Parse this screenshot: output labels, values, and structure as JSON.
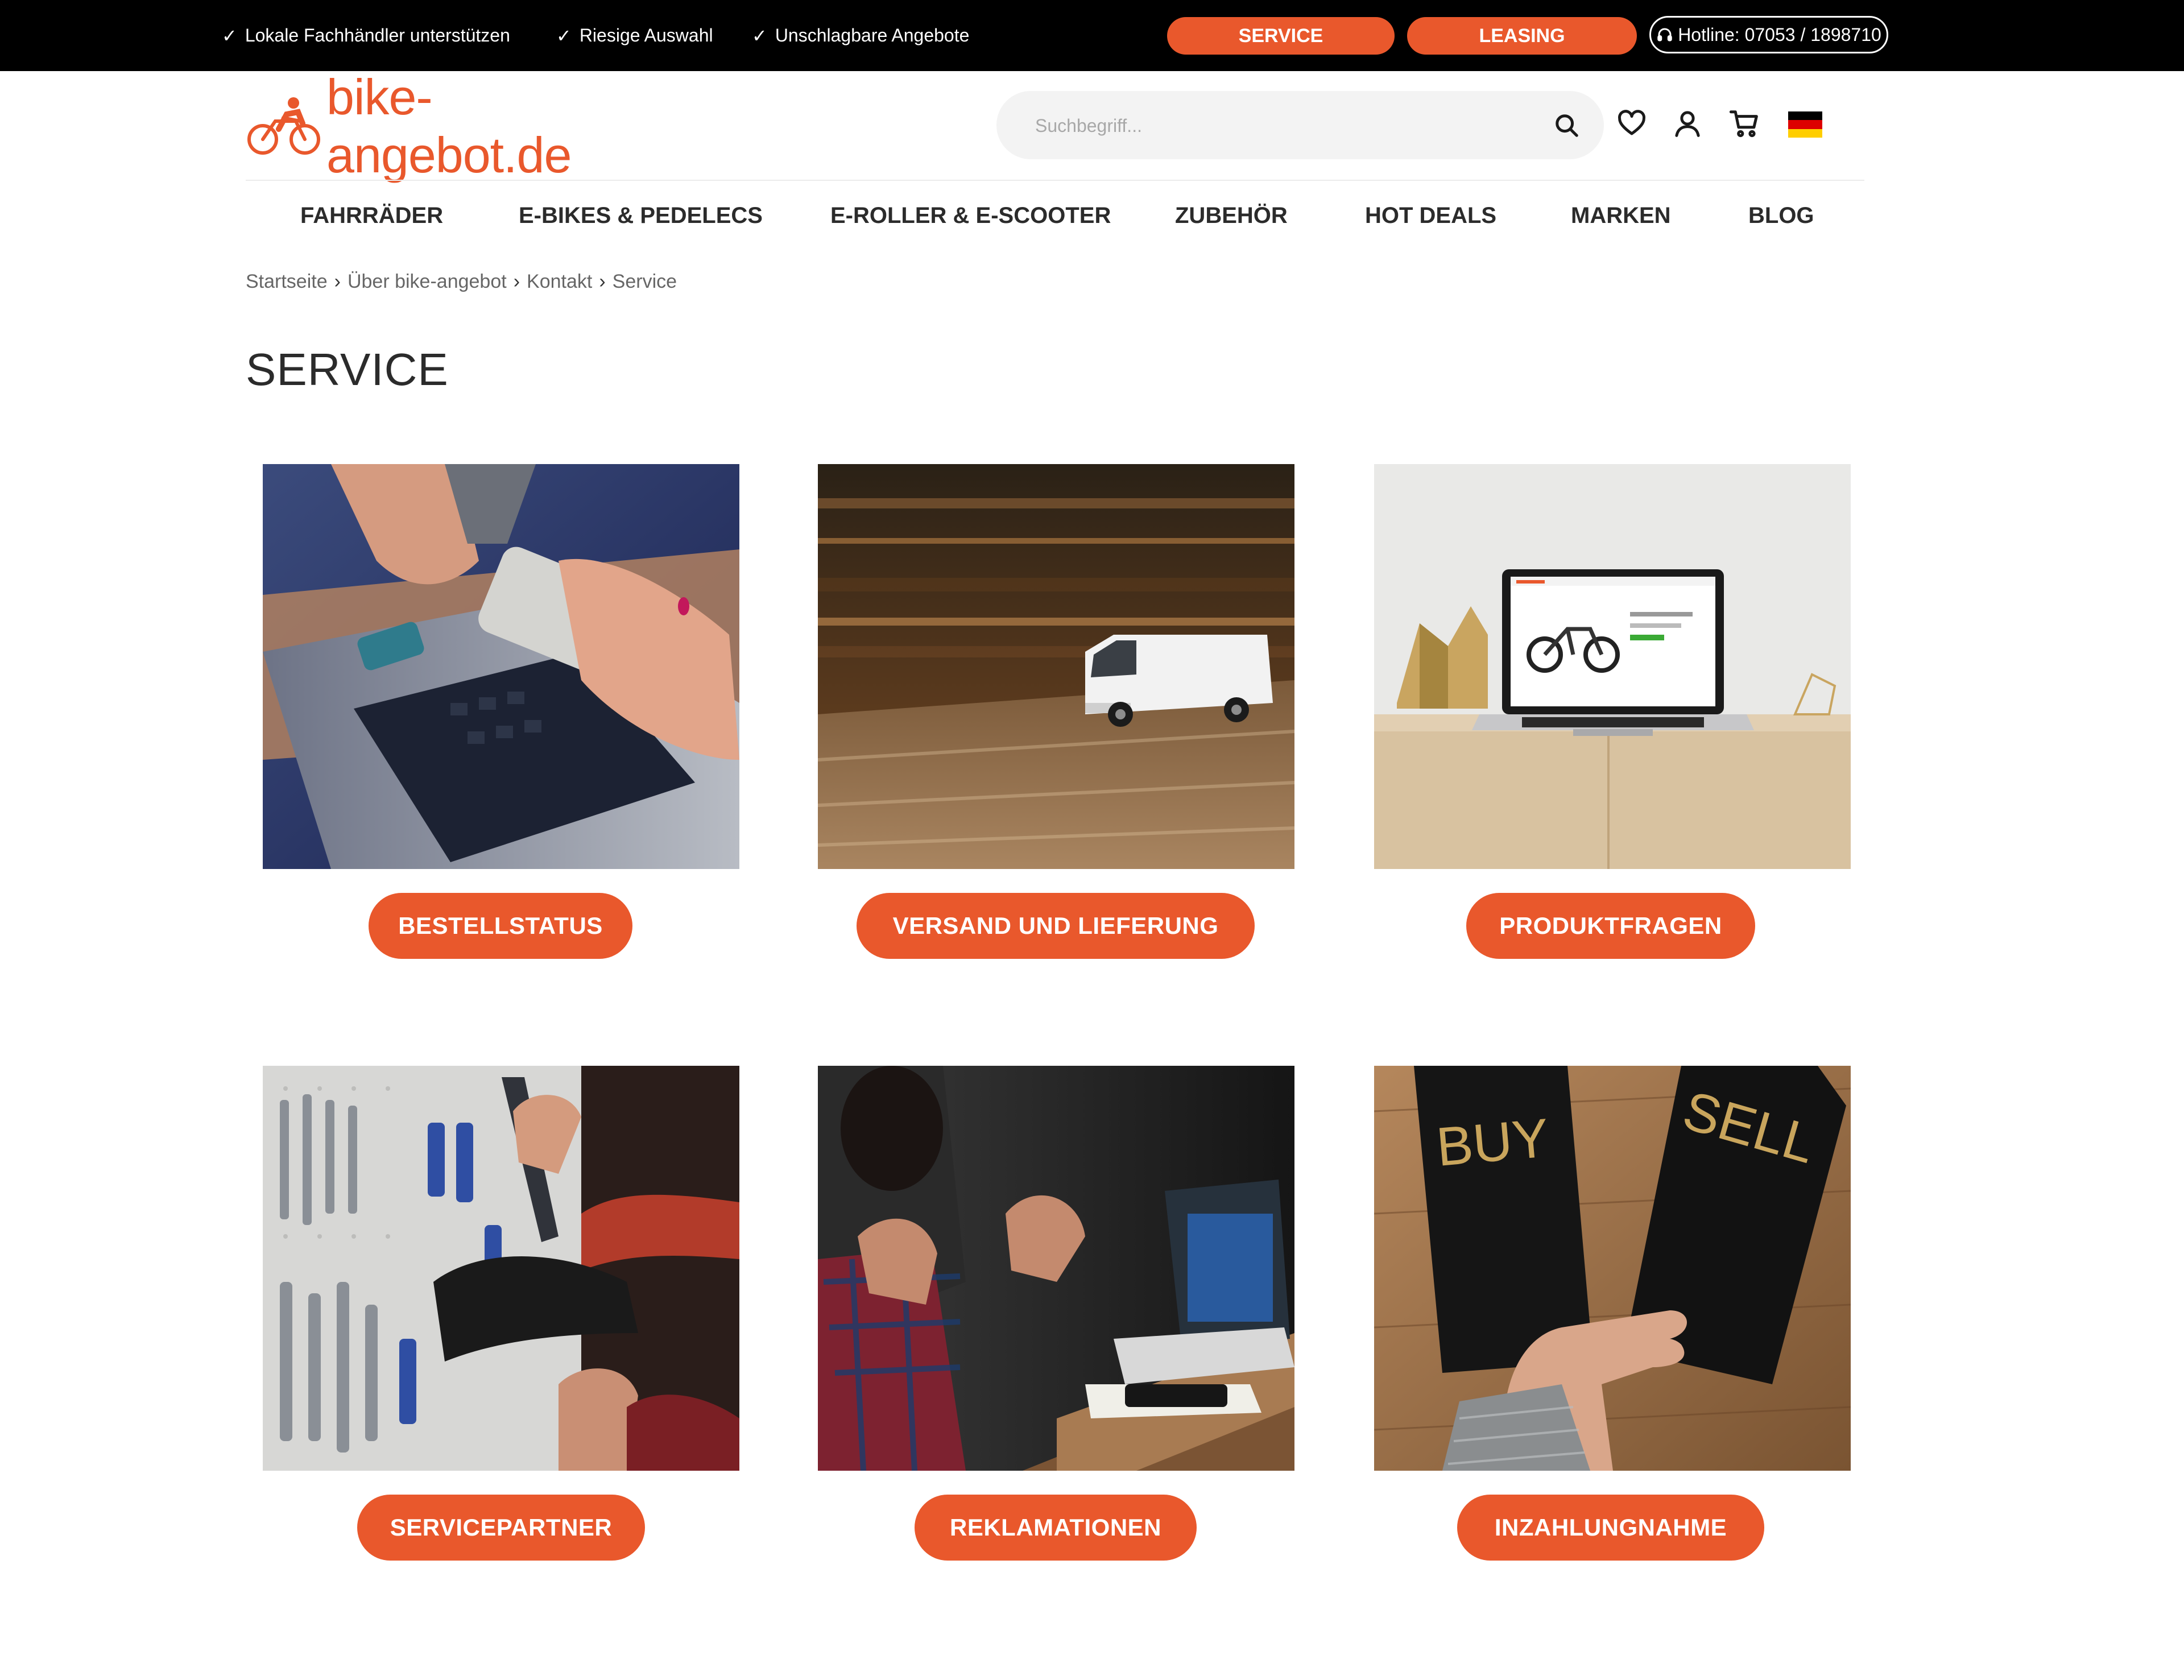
{
  "topbar": {
    "usps": [
      "Lokale Fachhändler unterstützen",
      "Riesige Auswahl",
      "Unschlagbare Angebote"
    ],
    "service_label": "SERVICE",
    "leasing_label": "LEASING",
    "hotline": "Hotline: 07053 / 1898710"
  },
  "header": {
    "logo_text": "bike-angebot.de",
    "search_placeholder": "Suchbegriff...",
    "icons": [
      "search-icon",
      "heart-icon",
      "user-icon",
      "cart-icon",
      "german-flag-icon"
    ]
  },
  "nav": {
    "items": [
      "FAHRRÄDER",
      "E-BIKES & PEDELECS",
      "E-ROLLER & E-SCOOTER",
      "ZUBEHÖR",
      "HOT DEALS",
      "MARKEN",
      "BLOG"
    ]
  },
  "breadcrumb": {
    "items": [
      "Startseite",
      "Über bike-angebot",
      "Kontakt",
      "Service"
    ]
  },
  "page": {
    "title": "SERVICE"
  },
  "tiles": [
    {
      "label": "BESTELLSTATUS"
    },
    {
      "label": "VERSAND UND LIEFERUNG"
    },
    {
      "label": "PRODUKTFRAGEN"
    },
    {
      "label": "SERVICEPARTNER"
    },
    {
      "label": "REKLAMATIONEN"
    },
    {
      "label": "INZAHLUNGNAHME"
    }
  ],
  "photo_text": {
    "buy": "BUY",
    "sell": "SELL"
  },
  "colors": {
    "accent": "#e9582c",
    "topbar_bg": "#000000"
  }
}
